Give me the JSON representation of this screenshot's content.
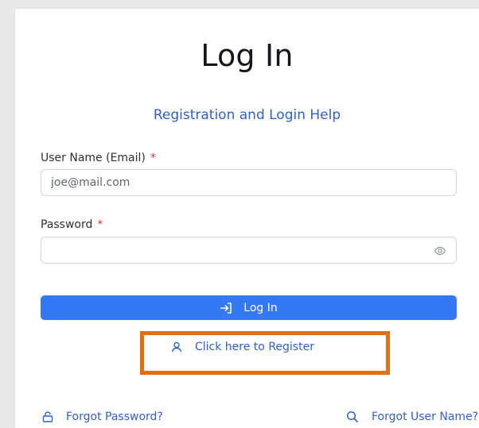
{
  "title": "Log In",
  "help_link": "Registration and Login Help",
  "username": {
    "label": "User Name (Email)",
    "required_mark": "*",
    "placeholder": "joe@mail.com",
    "value": ""
  },
  "password": {
    "label": "Password",
    "required_mark": "*",
    "value": ""
  },
  "login_button": "Log In",
  "register_link": "Click here to Register",
  "forgot_password": "Forgot Password?",
  "forgot_username": "Forgot User Name?",
  "colors": {
    "accent": "#3478f6",
    "link": "#2d5fcf",
    "required": "#e0322b",
    "highlight": "#e06f16"
  },
  "icons": {
    "login_button": "login-arrow-icon",
    "register": "user-icon",
    "forgot_password": "lock-icon",
    "forgot_username": "search-icon",
    "password_toggle": "eye-icon"
  }
}
